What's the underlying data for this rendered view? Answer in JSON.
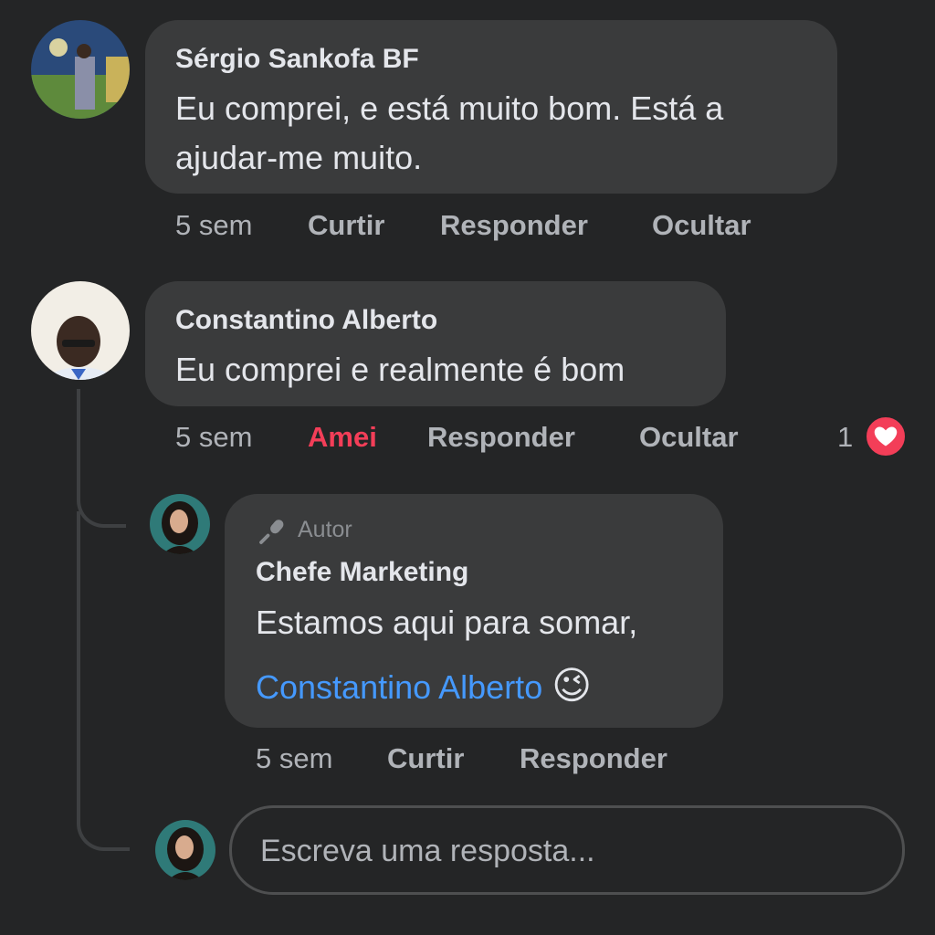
{
  "comments": [
    {
      "author": "Sérgio Sankofa BF",
      "text": "Eu comprei, e está muito bom. Está a ajudar-me muito.",
      "time": "5 sem",
      "actions": [
        "Curtir",
        "Responder",
        "Ocultar"
      ]
    },
    {
      "author": "Constantino Alberto",
      "text": "Eu comprei e realmente é bom",
      "time": "5 sem",
      "actions": [
        "Amei",
        "Responder",
        "Ocultar"
      ],
      "reaction_count": "1",
      "reaction_icon": "heart-icon",
      "reaction_color": "#f33e58"
    }
  ],
  "reply": {
    "badge": "Autor",
    "badge_icon": "microphone-icon",
    "author": "Chefe Marketing",
    "text_line1": "Estamos aqui para somar,",
    "mention": "Constantino Alberto",
    "emoji": "😉",
    "time": "5 sem",
    "actions": [
      "Curtir",
      "Responder"
    ]
  },
  "composer": {
    "placeholder": "Escreva uma resposta..."
  },
  "colors": {
    "background": "#242526",
    "bubble": "#3a3b3c",
    "loved": "#f33e58",
    "mention": "#4599ff"
  }
}
